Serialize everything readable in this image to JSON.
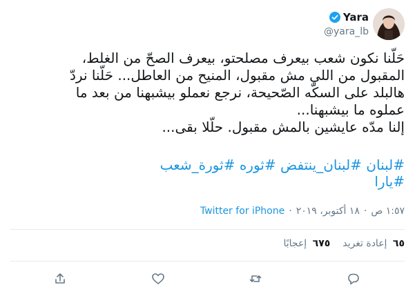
{
  "user": {
    "display_name": "Yara",
    "handle": "@yara_lb",
    "verified": true
  },
  "tweet": {
    "lines": [
      "حَلّنا نكون شعب بيعرف مصلحتو، بيعرف الصحّ من الغلط،",
      "المقبول من اللي مش مقبول، المنيح من العاطل... حَلّنا نردّ",
      "هالبلد على السكّه الصّحيحة، نرجع نعملو بيشبهنا من بعد ما",
      "عملوه ما بيشبهنا...",
      "إلنا مدّه عايشين بالمش مقبول. حلّلا بقى..."
    ],
    "hashtags_row1": [
      "#لبنان",
      "#لبنان_ينتفض",
      "#ثوره",
      "#ثورة_شعب"
    ],
    "hashtags_row2": [
      "#يارا"
    ]
  },
  "meta": {
    "time": "١:٥٧ ص",
    "separator": "·",
    "date": "١٨ أكتوبر، ٢٠١٩",
    "source": "Twitter for iPhone"
  },
  "stats": {
    "retweets_count": "٦٥",
    "retweets_label": "إعادة تغريد",
    "likes_count": "٦٧٥",
    "likes_label": "إعجابًا"
  },
  "actions": [
    "reply-icon",
    "retweet-icon",
    "like-icon",
    "share-icon"
  ],
  "colors": {
    "link": "#1b95e0",
    "verified": "#1da1f2",
    "muted": "#657786"
  }
}
